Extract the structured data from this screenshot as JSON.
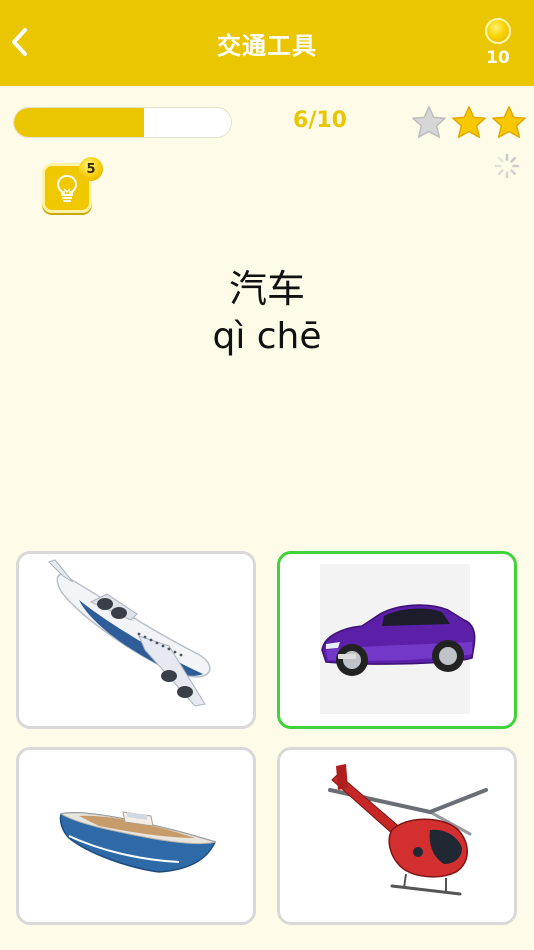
{
  "header": {
    "title": "交通工具",
    "back_icon": "chevron-left-icon",
    "coin_icon": "coin-icon",
    "coins": "10",
    "background": "#e9c600"
  },
  "progress": {
    "label": "6/10",
    "fraction": 0.6,
    "stars": [
      {
        "state": "empty",
        "color": "#cfcfcf"
      },
      {
        "state": "filled",
        "color": "#f5c300"
      },
      {
        "state": "filled",
        "color": "#f5c300"
      }
    ]
  },
  "hint": {
    "icon": "lightbulb-icon",
    "count": "5"
  },
  "question": {
    "word": "汽车",
    "pinyin": "qì chē"
  },
  "choices": [
    {
      "name": "airplane",
      "icon": "airplane-image",
      "selected": false
    },
    {
      "name": "car",
      "icon": "car-image",
      "selected": true,
      "selected_color": "#41d23d"
    },
    {
      "name": "boat",
      "icon": "boat-image",
      "selected": false
    },
    {
      "name": "helicopter",
      "icon": "helicopter-image",
      "selected": false
    }
  ]
}
